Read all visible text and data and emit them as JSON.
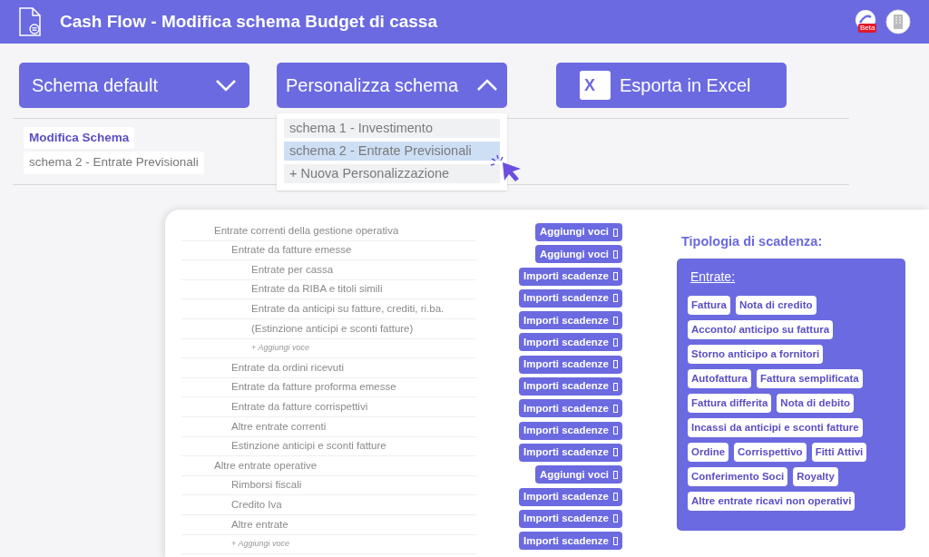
{
  "header": {
    "title": "Cash Flow - Modifica schema Budget di cassa",
    "badge": "Beta"
  },
  "toolbar": {
    "schema_default": {
      "label": "Schema default",
      "expanded": false
    },
    "personalizza": {
      "label": "Personalizza schema",
      "expanded": true
    },
    "export": {
      "label": "Esporta in Excel",
      "icon_letter": "X"
    }
  },
  "dropdown": [
    {
      "label": "schema 1 - Investimento",
      "selected": false
    },
    {
      "label": "schema 2 - Entrate Previsionali",
      "selected": true
    },
    {
      "label": "+ Nuova Personalizzazione",
      "selected": false
    }
  ],
  "current": {
    "title": "Modifica Schema",
    "value": "schema 2 - Entrate Previsionali"
  },
  "tree": [
    {
      "label": "Entrate correnti della gestione operativa",
      "kind": "item",
      "children": [
        {
          "label": "Entrate da fatture emesse",
          "kind": "item",
          "children": [
            {
              "label": "Entrate per cassa",
              "kind": "item"
            },
            {
              "label": "Entrate da RIBA e titoli simili",
              "kind": "item"
            },
            {
              "label": "Entrate da anticipi su fatture, crediti, ri.ba.",
              "kind": "item"
            },
            {
              "label": "(Estinzione anticipi e sconti fatture)",
              "kind": "item"
            },
            {
              "label": "+ Aggiungi voce",
              "kind": "add"
            }
          ]
        },
        {
          "label": "Entrate da ordini ricevuti",
          "kind": "item"
        },
        {
          "label": "Entrate da fatture proforma emesse",
          "kind": "item"
        },
        {
          "label": "Entrate da fatture corrispettivi",
          "kind": "item"
        },
        {
          "label": "Altre entrate correnti",
          "kind": "item"
        },
        {
          "label": "Estinzione anticipi e sconti fatture",
          "kind": "item"
        }
      ]
    },
    {
      "label": "Altre entrate operative",
      "kind": "item",
      "children": [
        {
          "label": "Rimborsi fiscali",
          "kind": "item"
        },
        {
          "label": "Credito Iva",
          "kind": "item"
        },
        {
          "label": "Altre entrate",
          "kind": "item"
        },
        {
          "label": "+ Aggiungi voce",
          "kind": "add"
        }
      ]
    }
  ],
  "actions": [
    "Aggiungi voci",
    "Aggiungi voci",
    "Importi scadenze",
    "Importi scadenze",
    "Importi scadenze",
    "Importi scadenze",
    "Importi scadenze",
    "Importi scadenze",
    "Importi scadenze",
    "Importi scadenze",
    "Importi scadenze",
    "Aggiungi voci",
    "Importi scadenze",
    "Importi scadenze",
    "Importi scadenze"
  ],
  "tipologia": {
    "title": "Tipologia di scadenza:",
    "group": "Entrate:",
    "tag_rows": [
      [
        "Fattura",
        "Nota di credito"
      ],
      [
        "Acconto/ anticipo su fattura"
      ],
      [
        "Storno anticipo a fornitori"
      ],
      [
        "Autofattura",
        "Fattura semplificata"
      ],
      [
        "Fattura differita",
        "Nota di debito"
      ],
      [
        "Incassi da anticipi e sconti fatture"
      ],
      [
        "Ordine",
        "Corrispettivo",
        "Fitti Attivi"
      ],
      [
        "Conferimento Soci",
        "Royalty"
      ],
      [
        "Altre entrate ricavi non operativi"
      ]
    ]
  }
}
